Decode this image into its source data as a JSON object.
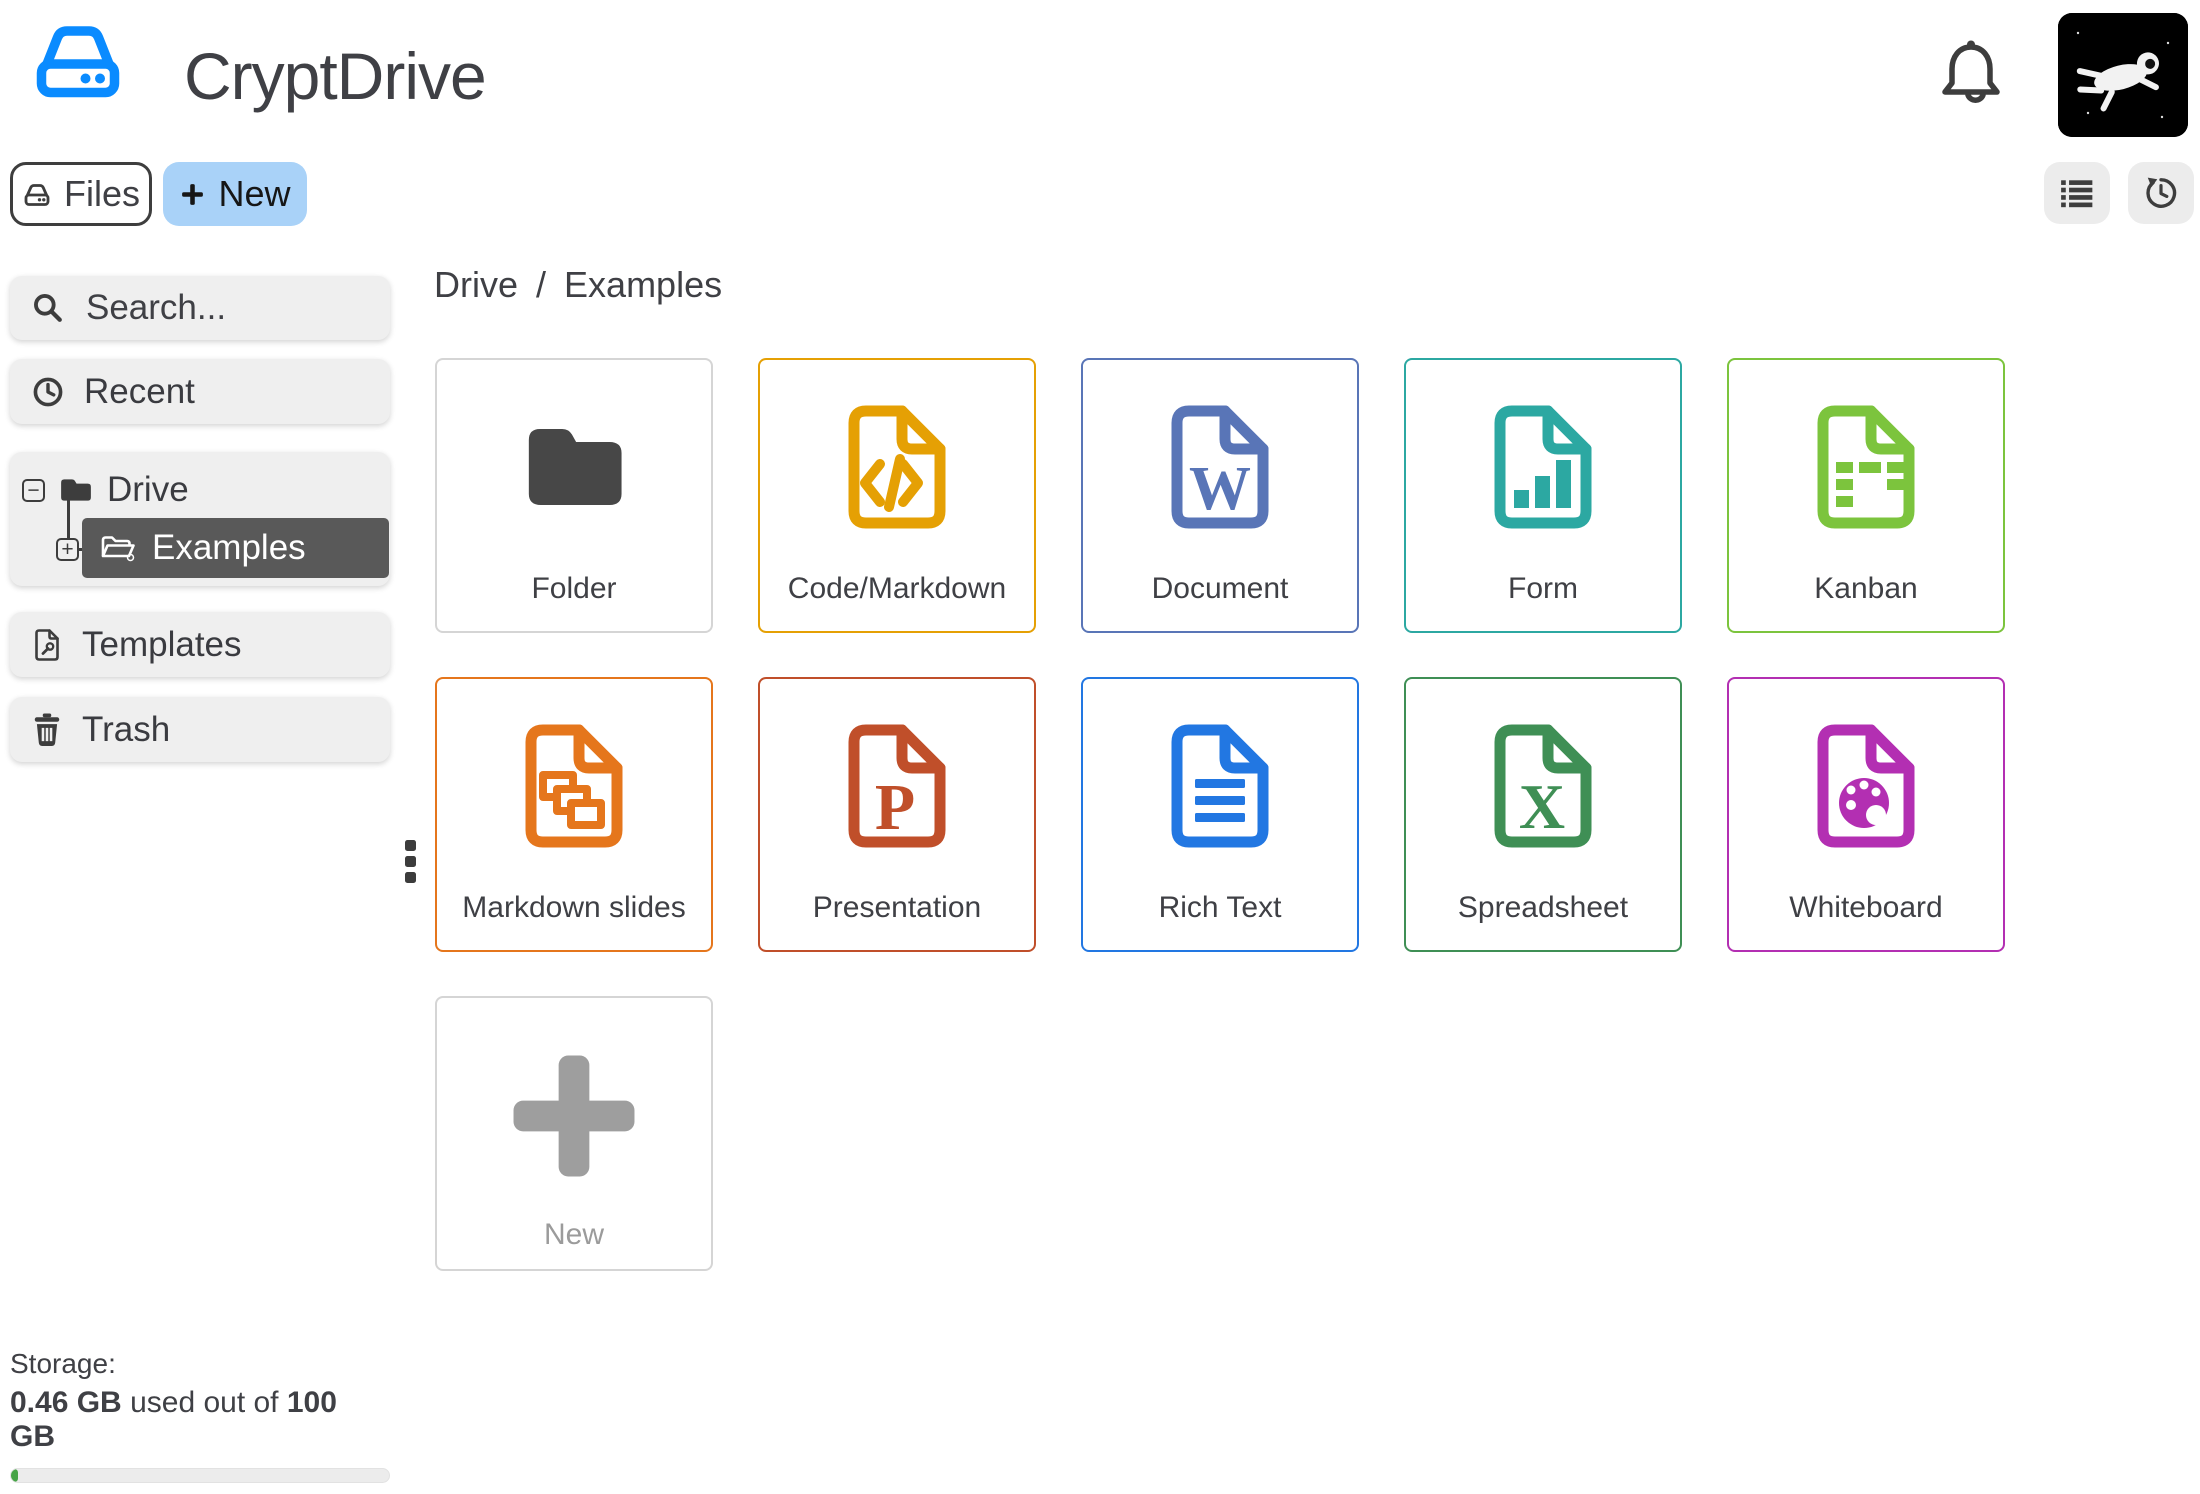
{
  "header": {
    "app_title": "CryptDrive",
    "logo_color": "#0a8bff"
  },
  "toolbar": {
    "files_label": "Files",
    "new_label": "New"
  },
  "breadcrumb": {
    "root": "Drive",
    "separator": "/",
    "current": "Examples"
  },
  "sidebar": {
    "search_placeholder": "Search...",
    "recent_label": "Recent",
    "drive_label": "Drive",
    "examples_label": "Examples",
    "templates_label": "Templates",
    "trash_label": "Trash"
  },
  "storage": {
    "label": "Storage:",
    "used": "0.46 GB",
    "infix": " used out of ",
    "total": "100 GB",
    "percent_used": 0.46,
    "bar_color": "#47a447"
  },
  "selection_color": "#595959",
  "tiles": [
    {
      "label": "Folder",
      "kind": "folder",
      "color": "#474747",
      "border": "#d5d5d5"
    },
    {
      "label": "Code/Markdown",
      "kind": "code",
      "color": "#e5a004",
      "border": "#e5a004"
    },
    {
      "label": "Document",
      "kind": "document",
      "color": "#5975b7",
      "border": "#5975b7"
    },
    {
      "label": "Form",
      "kind": "form",
      "color": "#2ca8a2",
      "border": "#2ca8a2"
    },
    {
      "label": "Kanban",
      "kind": "kanban",
      "color": "#7cc43d",
      "border": "#7cc43d"
    },
    {
      "label": "Markdown slides",
      "kind": "slides",
      "color": "#e5761c",
      "border": "#e5761c"
    },
    {
      "label": "Presentation",
      "kind": "presentation",
      "color": "#c04f2a",
      "border": "#c04f2a"
    },
    {
      "label": "Rich Text",
      "kind": "richtext",
      "color": "#2277e2",
      "border": "#2277e2"
    },
    {
      "label": "Spreadsheet",
      "kind": "spreadsheet",
      "color": "#3f8f55",
      "border": "#3f8f55"
    },
    {
      "label": "Whiteboard",
      "kind": "whiteboard",
      "color": "#b32fb2",
      "border": "#b32fb2"
    },
    {
      "label": "New",
      "kind": "new",
      "color": "#9e9e9e",
      "border": "#d5d5d5"
    }
  ]
}
